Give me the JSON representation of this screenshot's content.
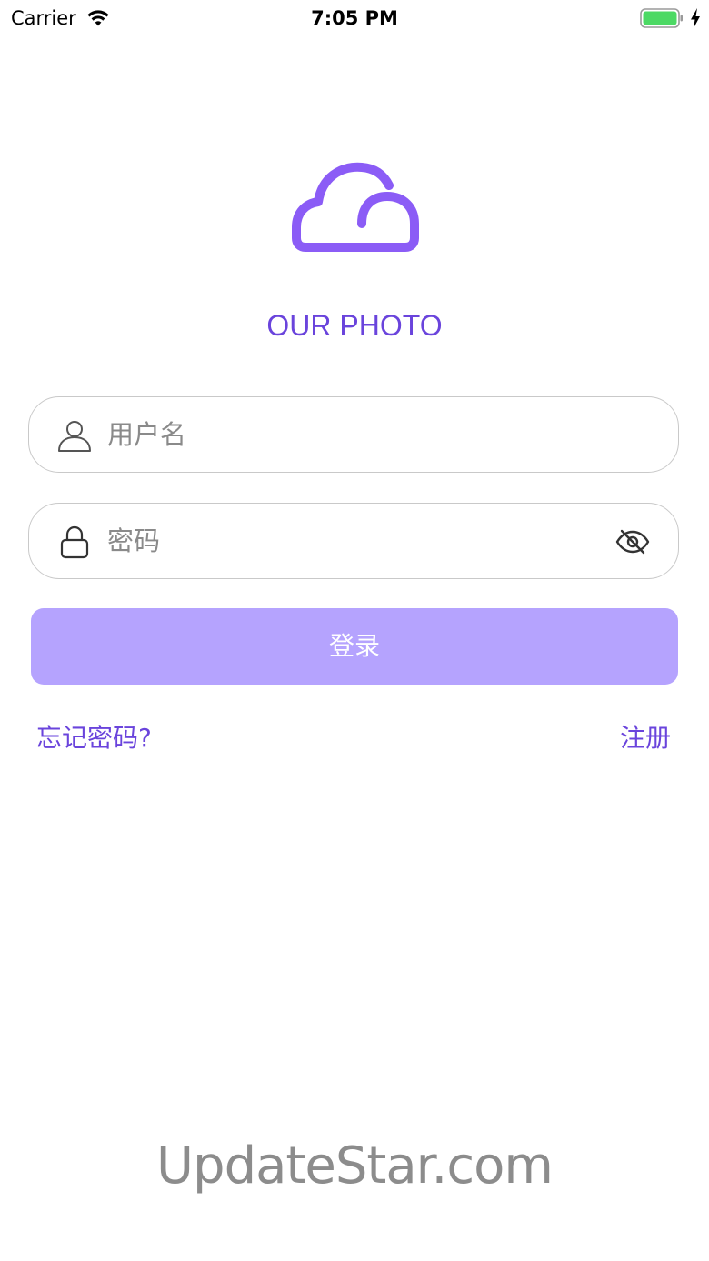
{
  "status_bar": {
    "carrier": "Carrier",
    "time": "7:05 PM",
    "wifi_icon": "wifi-icon",
    "battery_icon": "battery-full-icon",
    "charging_icon": "charging-bolt-icon"
  },
  "app": {
    "logo_icon": "cloud-icon",
    "title": "OUR PHOTO",
    "accent_color": "#6a44dc",
    "logo_color": "#8b5cf6"
  },
  "login_form": {
    "username": {
      "icon": "user-icon",
      "placeholder": "用户名",
      "value": ""
    },
    "password": {
      "icon": "lock-icon",
      "placeholder": "密码",
      "value": "",
      "visibility_icon": "eye-off-icon"
    },
    "submit_label": "登录",
    "submit_color": "#b5a3fe"
  },
  "links": {
    "forgot_password": "忘记密码?",
    "register": "注册"
  },
  "watermark": "UpdateStar.com"
}
